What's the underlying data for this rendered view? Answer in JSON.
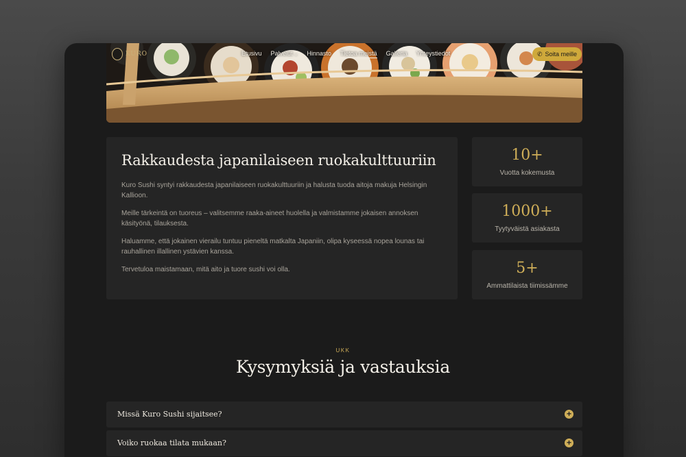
{
  "brand": {
    "logo_text": "KURO"
  },
  "nav": {
    "items": [
      {
        "label": "Etusivu"
      },
      {
        "label": "Palvelut"
      },
      {
        "label": "Hinnasto"
      },
      {
        "label": "Tietoa meistä"
      },
      {
        "label": "Galleria"
      },
      {
        "label": "Yhteystiedot"
      }
    ],
    "call_label": "Soita meille"
  },
  "about": {
    "title": "Rakkaudesta japanilaiseen ruokakulttuuriin",
    "paragraphs": [
      "Kuro Sushi syntyi rakkaudesta japanilaiseen ruokakulttuuriin ja halusta tuoda aitoja makuja Helsingin Kallioon.",
      "Meille tärkeintä on tuoreus – valitsemme raaka-aineet huolella ja valmistamme jokaisen annoksen käsityönä, tilauksesta.",
      "Haluamme, että jokainen vierailu tuntuu pieneltä matkalta Japaniin, olipa kyseessä nopea lounas tai rauhallinen illallinen ystävien kanssa.",
      "Tervetuloa maistamaan, mitä aito ja tuore sushi voi olla."
    ]
  },
  "stats": [
    {
      "value": "10+",
      "label": "Vuotta kokemusta"
    },
    {
      "value": "1000+",
      "label": "Tyytyväistä asiakasta"
    },
    {
      "value": "5+",
      "label": "Ammattilaista tiimissämme"
    }
  ],
  "faq": {
    "eyebrow": "UKK",
    "title": "Kysymyksiä ja vastauksia",
    "items": [
      {
        "question": "Missä Kuro Sushi sijaitsee?"
      },
      {
        "question": "Voiko ruokaa tilata mukaan?"
      }
    ]
  },
  "colors": {
    "accent": "#cfae58",
    "button": "#cfa93b",
    "card": "#252525",
    "background": "#1b1b1b"
  }
}
